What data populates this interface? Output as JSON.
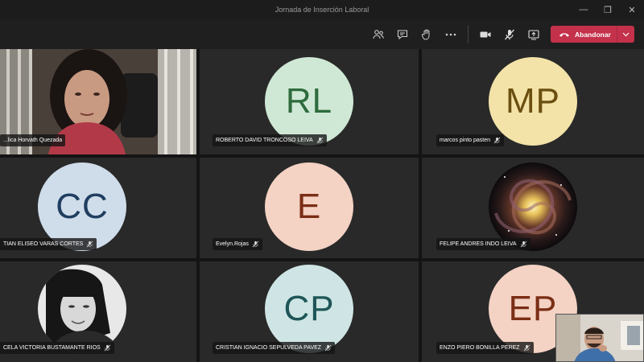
{
  "window": {
    "title": "Jornada de Inserción Laboral"
  },
  "toolbar": {
    "icons": [
      "people-icon",
      "chat-icon",
      "raise-hand-icon",
      "more-options-icon",
      "camera-icon",
      "mic-muted-icon",
      "share-screen-icon"
    ],
    "leave_label": "Abandonar"
  },
  "colors": {
    "leave_red": "#c4314b",
    "tile_bg": "#292929"
  },
  "participants": [
    {
      "name": "...lica Horvath Quezada",
      "type": "video"
    },
    {
      "name": "ROBERTO DAVID TRONCOSO LEIVA",
      "initials": "RL",
      "bg": "#cfe8d5",
      "fg": "#2e6b3d"
    },
    {
      "name": "marcos pinto pasten",
      "initials": "MP",
      "bg": "#f3e3a8",
      "fg": "#6b4f10"
    },
    {
      "name": "TIAN ELISEO VARAS CORTES",
      "initials": "CC",
      "bg": "#cfdcea",
      "fg": "#1f3e60"
    },
    {
      "name": "Evelyn.Rojas",
      "initials": "E",
      "bg": "#f4d2c4",
      "fg": "#7a2e15"
    },
    {
      "name": "FELIPE ANDRES INDO LEIVA",
      "type": "galaxy"
    },
    {
      "name": "CELA VICTORIA BUSTAMANTE RIOS",
      "type": "bw-photo"
    },
    {
      "name": "CRISTIAN IGNACIO SEPULVEDA PAVEZ",
      "initials": "CP",
      "bg": "#cfe5e5",
      "fg": "#1f5658"
    },
    {
      "name": "ENZO PIERO BONILLA PEREZ",
      "initials": "EP",
      "bg": "#f4d2c4",
      "fg": "#7a2e15"
    }
  ]
}
